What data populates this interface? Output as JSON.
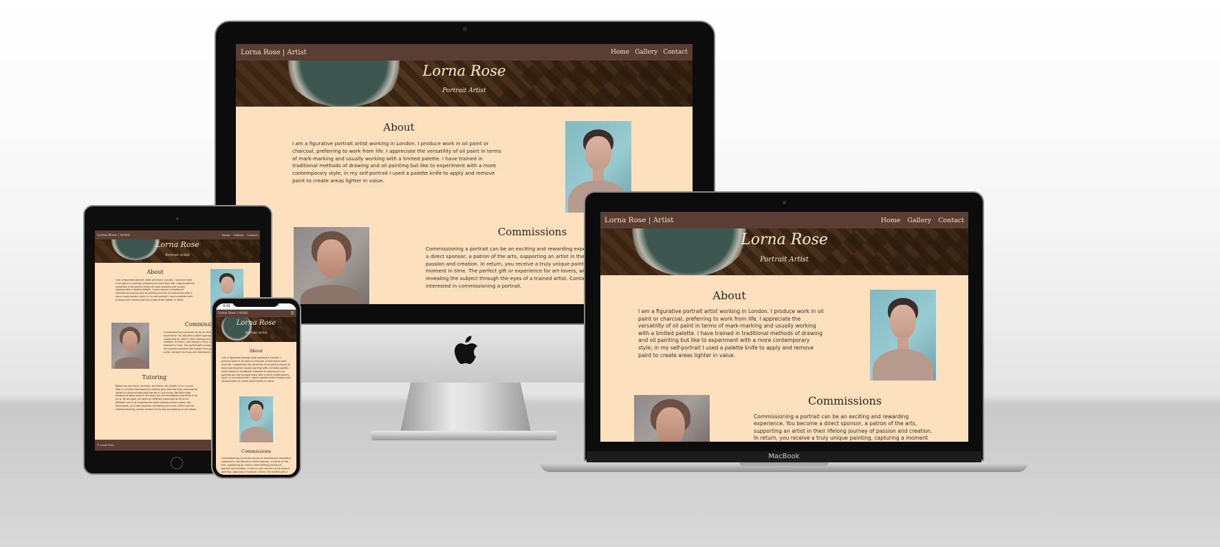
{
  "site": {
    "brand": "Lorna Rose | Artist",
    "nav": [
      "Home",
      "Gallery",
      "Contact"
    ],
    "hero_title": "Lorna Rose",
    "hero_subtitle": "Portrait Artist",
    "about_heading": "About",
    "about_text": "I am a figurative portrait artist working in London. I produce work in oil paint or charcoal, preferring to work from life. I appreciate the versatility of oil paint in terms of mark-marking and usually working with a limited palette. I have trained in traditional methods of drawing and oil painting but like to experiment with a more contemporary style; in my self-portrait I used a palette knife to apply and remove paint to create areas lighter in value.",
    "commissions_heading": "Commissions",
    "commissions_text": "Commissioning a portrait can be an exciting and rewarding experience. You become a direct sponsor, a patron of the arts, supporting an artist in their lifelong journey of passion and creation. In return, you receive a truly unique painting, capturing a moment in time. The perfect gift or experience for art-lovers, with the process revealing the subject through the eyes of a trained artist. Contact me if you are interested in commissioning a portrait.",
    "tutoring_heading": "Tutoring",
    "tutoring_text": "Before we can write, we draw, we sketch, we doodle. It is a crucial step in a child's development, helping play with learning, reaching our hands to communicate what we see in our minds. We often stop drawing at some point in our lives, but the foundations are there in all of us. As we grow, art takes on different meanings for all of us. Whether you're an experienced artist looking to learn some new techniques, or a total beginner rekindling your inner child's love for creative working, please contact me to discuss booking an art lesson.",
    "footer": "© Lorna Rose"
  },
  "devices": {
    "macbook_label": "MacBook",
    "iphone_time": "9:41"
  }
}
